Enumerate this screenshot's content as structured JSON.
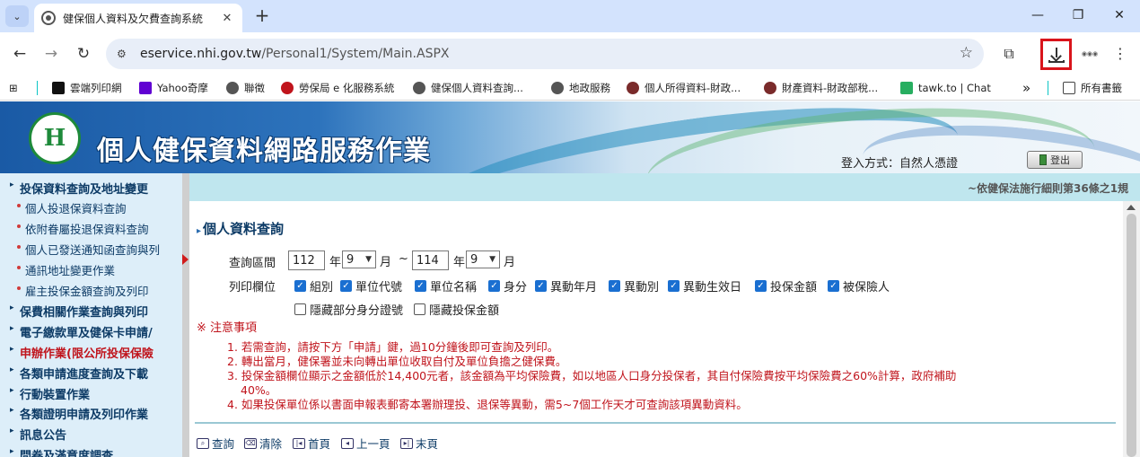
{
  "browser": {
    "tab": {
      "title": "健保個人資料及欠費查詢系統"
    },
    "window_controls": {
      "minimize": "—",
      "restore": "❐",
      "close": "✕"
    },
    "url": {
      "host": "eservice.nhi.gov.tw",
      "path": "/Personal1/System/Main.ASPX"
    },
    "bookmarks": [
      {
        "label": "雲端列印網",
        "icon": "ibon-icon",
        "color": "#111111"
      },
      {
        "label": "Yahoo奇摩",
        "icon": "yahoo-icon",
        "color": "#6001d2"
      },
      {
        "label": "聯徵",
        "icon": "globe-icon",
        "color": "#444444"
      },
      {
        "label": "勞保局 e 化服務系統",
        "icon": "bli-icon",
        "color": "#c0141c"
      },
      {
        "label": "健保個人資料查詢...",
        "icon": "globe-icon",
        "color": "#444444"
      },
      {
        "label": "地政服務",
        "icon": "globe-icon",
        "color": "#444444"
      },
      {
        "label": "個人所得資料-財政...",
        "icon": "mof-icon",
        "color": "#7a2b2b"
      },
      {
        "label": "財產資料-財政部稅...",
        "icon": "mof-icon",
        "color": "#7a2b2b"
      },
      {
        "label": "tawk.to | Chat",
        "icon": "tawk-icon",
        "color": "#27ae60"
      }
    ],
    "bookmarks_overflow": "»",
    "all_bookmarks": "所有書籤"
  },
  "banner": {
    "logo_text": "H",
    "title": "個人健保資料網路服務作業",
    "login_label": "登入方式：自然人憑證",
    "logout_label": "登出"
  },
  "marquee": "~依健保法施行細則第36條之1規",
  "sidebar": {
    "sections": [
      {
        "label": "投保資料查詢及地址變更",
        "red": false
      },
      {
        "label": "保費相關作業查詢與列印",
        "red": false
      },
      {
        "label": "電子繳款單及健保卡申請/",
        "red": false
      },
      {
        "label": "申辦作業(限公所投保保險",
        "red": true
      },
      {
        "label": "各類申請進度查詢及下載",
        "red": false
      },
      {
        "label": "行動裝置作業",
        "red": false
      },
      {
        "label": "各類證明申請及列印作業",
        "red": false
      },
      {
        "label": "訊息公告",
        "red": false
      },
      {
        "label": "問卷及滿意度調查",
        "red": false
      }
    ],
    "sub_items": [
      "個人投退保資料查詢",
      "依附眷屬投退保資料查詢",
      "個人已發送通知函查詢與列",
      "通訊地址變更作業",
      "雇主投保金額查詢及列印"
    ]
  },
  "query": {
    "title": "個人資料查詢",
    "period_label": "查詢區間",
    "start_year": "112",
    "start_month": "9",
    "end_year": "114",
    "end_month": "9",
    "year_unit": "年",
    "month_unit": "月",
    "range_sep": "~",
    "print_fields_label": "列印欄位",
    "fields": [
      {
        "label": "組別",
        "checked": true
      },
      {
        "label": "單位代號",
        "checked": true
      },
      {
        "label": "單位名稱",
        "checked": true
      },
      {
        "label": "身分",
        "checked": true
      },
      {
        "label": "異動年月",
        "checked": true
      },
      {
        "label": "異動別",
        "checked": true
      },
      {
        "label": "異動生效日",
        "checked": true
      },
      {
        "label": "投保金額",
        "checked": true
      },
      {
        "label": "被保險人",
        "checked": true
      }
    ],
    "hide_options": [
      {
        "label": "隱藏部分身分證號",
        "checked": false
      },
      {
        "label": "隱藏投保金額",
        "checked": false
      }
    ]
  },
  "notes": {
    "title": "※ 注意事項",
    "items": [
      "1. 若需查詢，請按下方「申請」鍵，過10分鐘後即可查詢及列印。",
      "2. 轉出當月，健保署並未向轉出單位收取自付及單位負擔之健保費。",
      "3. 投保金額欄位顯示之金額低於14,400元者，該金額為平均保險費，如以地區人口身分投保者，其自付保險費按平均保險費之60%計算，政府補助",
      "40%。",
      "4. 如果投保單位係以書面申報表郵寄本署辦理投、退保等異動，需5~7個工作天才可查詢該項異動資料。"
    ]
  },
  "actions": [
    {
      "label": "查詢",
      "icon": "search-icon"
    },
    {
      "label": "清除",
      "icon": "clear-icon"
    },
    {
      "label": "首頁",
      "icon": "first-page-icon"
    },
    {
      "label": "上一頁",
      "icon": "previous-page-icon"
    },
    {
      "label": "末頁",
      "icon": "last-page-icon"
    }
  ],
  "colors": {
    "accent_red": "#c0141c",
    "nav_blue": "#0d3b66",
    "checkbox_blue": "#1a6fd1"
  }
}
